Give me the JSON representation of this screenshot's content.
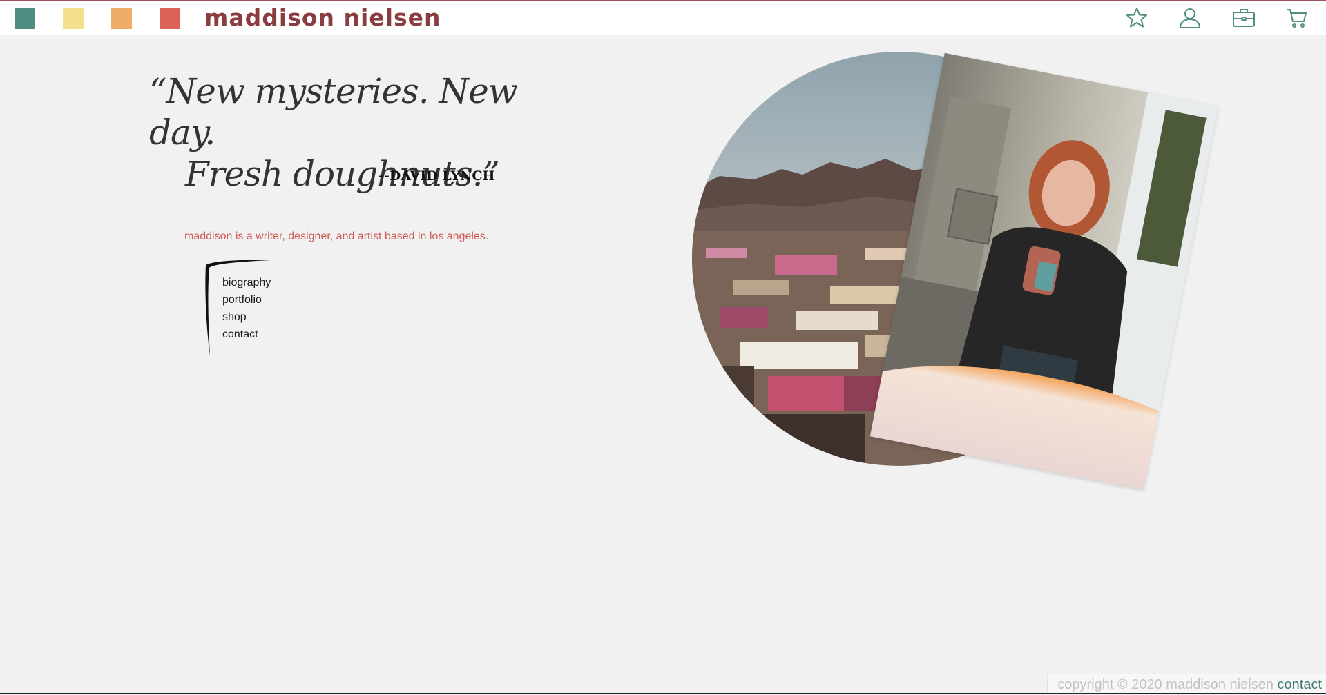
{
  "colors": {
    "teal": "#4f8c81",
    "yellow": "#f3e08e",
    "orange": "#f0ad6a",
    "red": "#dc6257",
    "brand": "#8a3d40",
    "icon": "#4f8c81",
    "tagline": "#cf5a55",
    "footer_link": "#3d7b74"
  },
  "header": {
    "swatches": [
      "teal-swatch",
      "yellow-swatch",
      "orange-swatch",
      "red-swatch"
    ],
    "brand": "maddison nielsen",
    "icons": [
      "star-icon",
      "user-icon",
      "briefcase-icon",
      "cart-icon"
    ]
  },
  "quote": {
    "line1": "“New mysteries. New day.",
    "line2": "Fresh doughnuts.”",
    "author": "--DAVID LYNCH"
  },
  "tagline": "maddison is a writer, designer, and artist based in los angeles.",
  "nav": {
    "items": [
      "biography",
      "portfolio",
      "shop",
      "contact"
    ]
  },
  "images": {
    "city": "los-angeles-hillside-photo",
    "portrait": "person-drinking-photo"
  },
  "footer": {
    "copyright": "copyright © 2020 maddison nielsen",
    "contact": "contact"
  }
}
